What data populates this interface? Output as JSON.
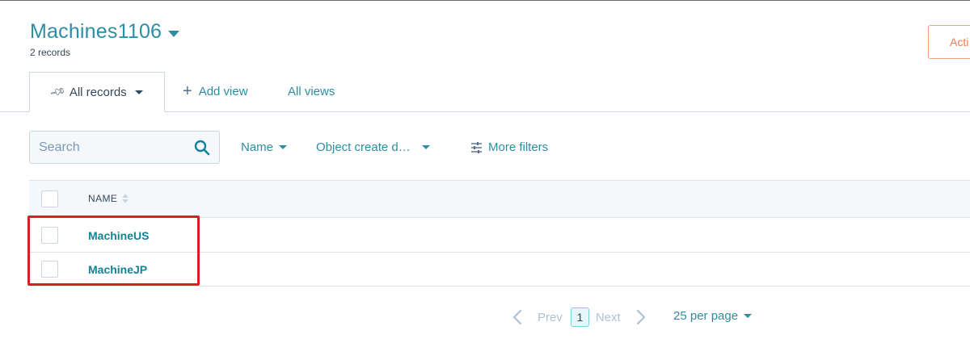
{
  "header": {
    "title": "Machines1106",
    "records_count": "2 records",
    "actions_label": "Acti"
  },
  "tabs": {
    "active_label": "All records",
    "add_view_label": "Add view",
    "all_views_label": "All views"
  },
  "filters": {
    "search_placeholder": "Search",
    "name_label": "Name",
    "create_date_label": "Object create d…",
    "more_filters_label": "More filters"
  },
  "table": {
    "column_name": "NAME",
    "rows": [
      {
        "name": "MachineUS"
      },
      {
        "name": "MachineJP"
      }
    ]
  },
  "pagination": {
    "prev_label": "Prev",
    "current_page": "1",
    "next_label": "Next",
    "per_page_label": "25 per page"
  },
  "colors": {
    "accent": "#2d8ea3",
    "link": "#0f8499",
    "highlight": "#d81f26",
    "action_border": "#f2a081"
  }
}
